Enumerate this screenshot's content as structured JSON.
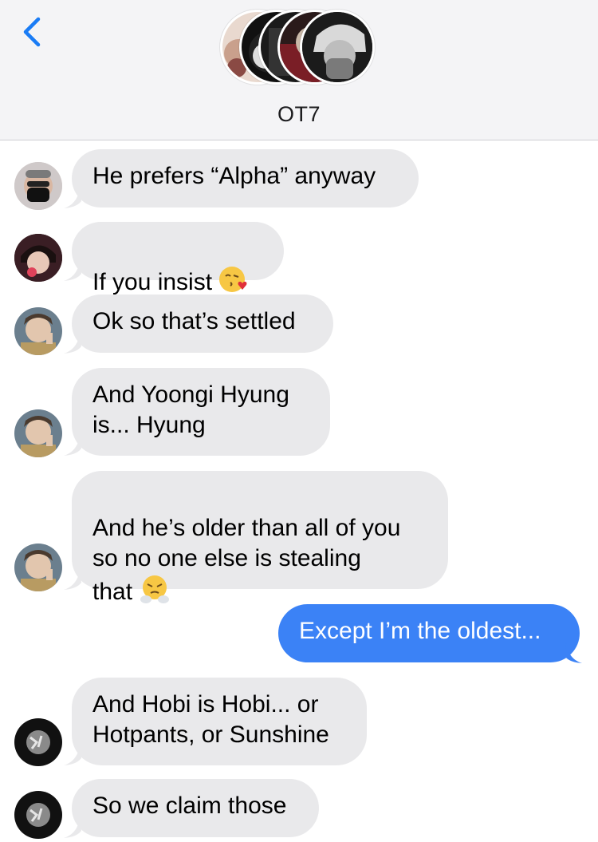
{
  "conversation": {
    "name": "OT7",
    "avatar_count": 5
  },
  "colors": {
    "header_bg": "#f4f4f6",
    "incoming_bubble": "#e9e9eb",
    "outgoing_bubble": "#3b82f6",
    "back_chevron": "#1a7cf5"
  },
  "messages": [
    {
      "direction": "incoming",
      "sender_avatar": "masked-person-avatar",
      "text": "He prefers “Alpha” anyway"
    },
    {
      "direction": "incoming",
      "sender_avatar": "lollipop-person-avatar",
      "text": "If you insist",
      "emoji": "kissing-face-with-heart"
    },
    {
      "direction": "incoming",
      "sender_avatar": "peace-sign-person-avatar",
      "text": "Ok so that’s settled"
    },
    {
      "direction": "incoming",
      "sender_avatar": "peace-sign-person-avatar",
      "text": "And Yoongi Hyung\nis... Hyung"
    },
    {
      "direction": "incoming",
      "sender_avatar": "peace-sign-person-avatar",
      "text": "And he’s older than all of you\nso no one else is stealing\nthat",
      "emoji": "face-with-steam-from-nose"
    },
    {
      "direction": "outgoing",
      "text": "Except I’m the oldest..."
    },
    {
      "direction": "incoming",
      "sender_avatar": "monochrome-person-avatar",
      "text": "And Hobi is Hobi... or\nHotpants, or Sunshine"
    },
    {
      "direction": "incoming",
      "sender_avatar": "monochrome-person-avatar",
      "text": "So we claim those"
    }
  ]
}
